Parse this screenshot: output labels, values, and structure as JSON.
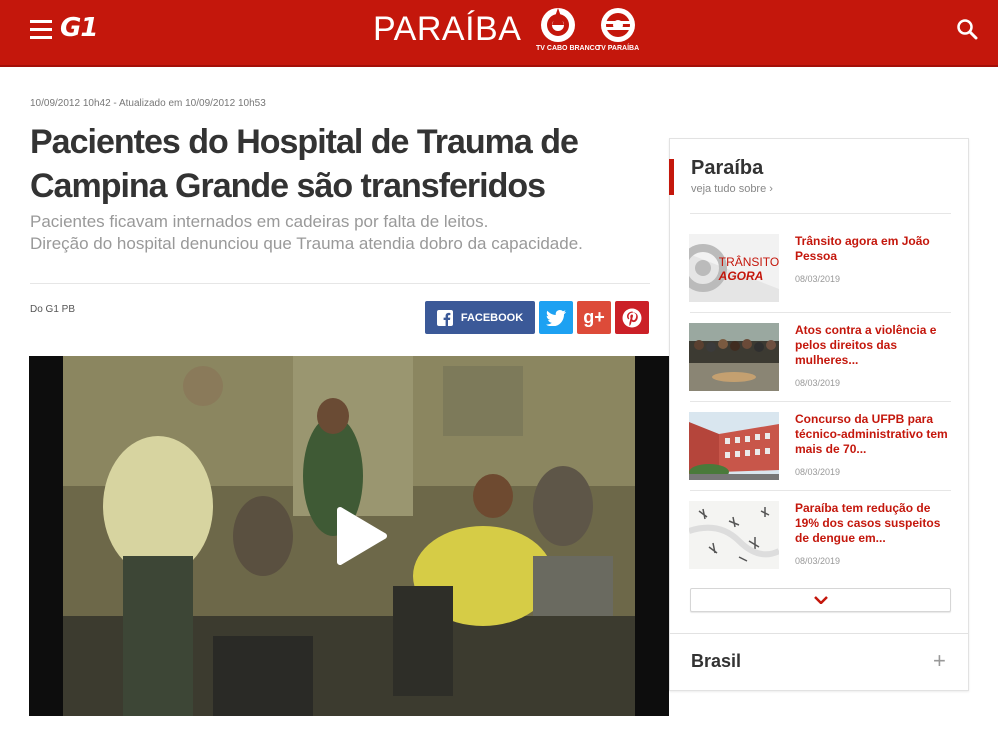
{
  "header": {
    "brand": "G1",
    "region": "PARAÍBA",
    "tv_logos": [
      "TV CABO BRANCO",
      "TV PARAÍBA"
    ],
    "colors": {
      "brand_red": "#c4170c"
    }
  },
  "article": {
    "meta": "10/09/2012 10h42 - Atualizado em 10/09/2012 10h53",
    "title": "Pacientes do Hospital de Trauma de Campina Grande são transferidos",
    "subtitle_line1": "Pacientes ficavam internados em cadeiras por falta de leitos.",
    "subtitle_line2": "Direção do hospital denunciou que Trauma atendia dobro da capacidade.",
    "source": "Do G1 PB",
    "share": {
      "facebook": "FACEBOOK",
      "twitter_icon": "twitter-icon",
      "gplus": "g+",
      "pinterest_icon": "pinterest-icon"
    }
  },
  "sidebar": {
    "title": "Paraíba",
    "more": "veja tudo sobre ›",
    "items": [
      {
        "headline": "Trânsito agora em João Pessoa",
        "date": "08/03/2019",
        "thumb_text_1": "TRÂNSITO",
        "thumb_text_2": "AGORA"
      },
      {
        "headline": "Atos contra a violência e pelos direitos das mulheres...",
        "date": "08/03/2019"
      },
      {
        "headline": "Concurso da UFPB para técnico-administrativo tem mais de 70...",
        "date": "08/03/2019"
      },
      {
        "headline": "Paraíba tem redução de 19% dos casos suspeitos de dengue em...",
        "date": "08/03/2019"
      }
    ],
    "next_section": "Brasil"
  }
}
